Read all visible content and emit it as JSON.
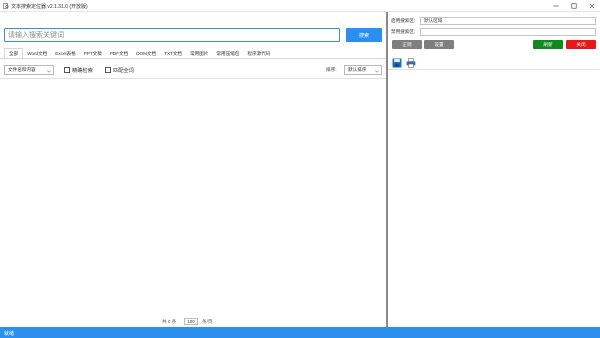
{
  "window": {
    "title": "文本搜索定位器 v2.1.31.0 (开放版)",
    "controls": {
      "minimize_icon": "minimize-icon",
      "maximize_icon": "maximize-icon",
      "close_icon": "close-icon"
    }
  },
  "search": {
    "placeholder": "请输入搜索关键词",
    "button_label": "搜索"
  },
  "tabs": [
    {
      "label": "全部",
      "active": true
    },
    {
      "label": "Word文档",
      "active": false
    },
    {
      "label": "Excel表格",
      "active": false
    },
    {
      "label": "PPT文稿",
      "active": false
    },
    {
      "label": "PDF文档",
      "active": false
    },
    {
      "label": "DOM文档",
      "active": false
    },
    {
      "label": "TXT文档",
      "active": false
    },
    {
      "label": "常用图片",
      "active": false
    },
    {
      "label": "常用压缩包",
      "active": false
    },
    {
      "label": "程序源代码",
      "active": false
    }
  ],
  "filter": {
    "scope_select_value": "文件名和内容",
    "exact_match_label": "精确检索",
    "whole_word_label": "匹配全词",
    "sort_label": "排序:",
    "sort_select_value": "默认排序"
  },
  "pager": {
    "count_text": "共 0 条",
    "page_size": "100",
    "unit_text": "条/页"
  },
  "right_panel": {
    "enabled_area_label": "启用搜索区:",
    "enabled_area_value": "默认区域",
    "disabled_area_label": "禁用搜索区:",
    "disabled_area_value": "",
    "buttons": {
      "index_label": "正则",
      "settings_label": "设置",
      "refresh_label": "刷新",
      "close_label": "关闭"
    },
    "toolbar_icons": [
      "save-icon",
      "print-icon"
    ]
  },
  "status": {
    "text": "就绪"
  },
  "colors": {
    "accent": "#2b8ff0",
    "gray_button": "#7f7f7f",
    "green_button": "#0f8a1c",
    "red_button": "#e81818",
    "status_bar": "#2b8ff0"
  }
}
